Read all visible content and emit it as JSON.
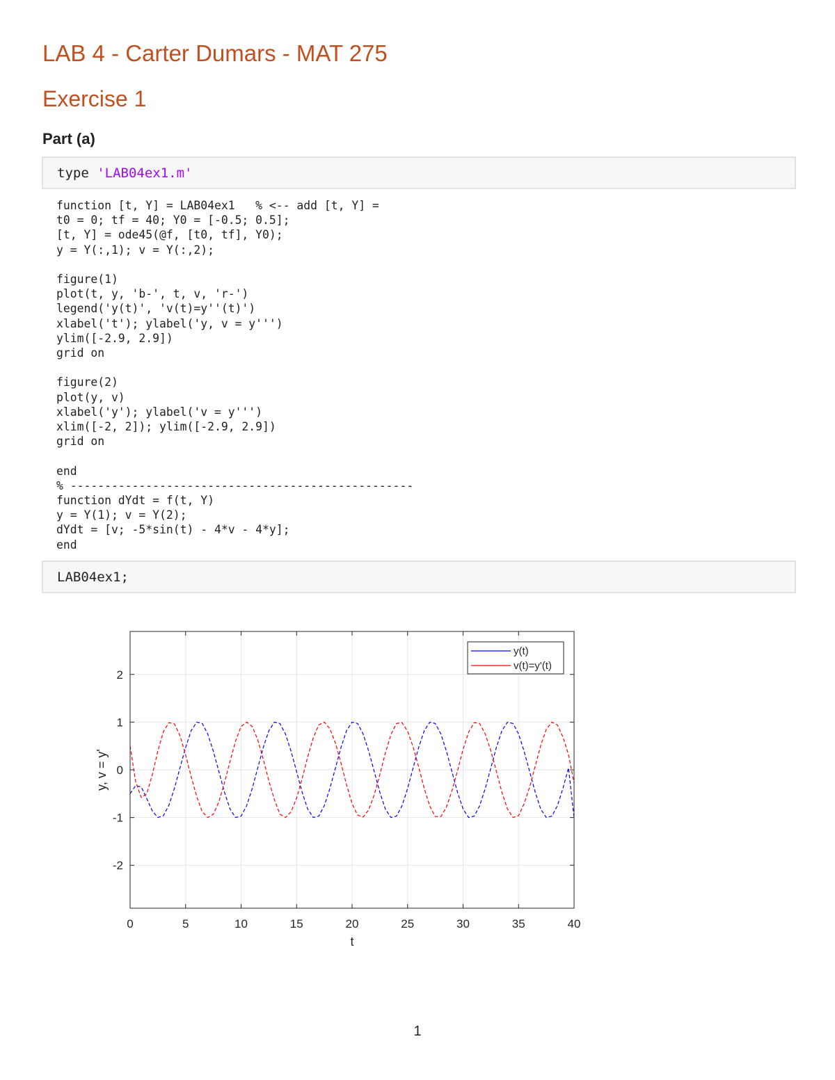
{
  "title": "LAB 4 - Carter Dumars - MAT 275",
  "section": "Exercise 1",
  "subsection": "Part (a)",
  "command1": {
    "keyword": "type",
    "argument": "'LAB04ex1.m'"
  },
  "code_lines": [
    "function [t, Y] = LAB04ex1   % <-- add [t, Y] =",
    "t0 = 0; tf = 40; Y0 = [-0.5; 0.5];",
    "[t, Y] = ode45(@f, [t0, tf], Y0);",
    "y = Y(:,1); v = Y(:,2);",
    "",
    "figure(1)",
    "plot(t, y, 'b-', t, v, 'r-')",
    "legend('y(t)', 'v(t)=y''(t)')",
    "xlabel('t'); ylabel('y, v = y''')",
    "ylim([-2.9, 2.9])",
    "grid on",
    "",
    "figure(2)",
    "plot(y, v)",
    "xlabel('y'); ylabel('v = y''')",
    "xlim([-2, 2]); ylim([-2.9, 2.9])",
    "grid on",
    "",
    "end",
    "% --------------------------------------------------",
    "function dYdt = f(t, Y)",
    "y = Y(1); v = Y(2);",
    "dYdt = [v; -5*sin(t) - 4*v - 4*y];",
    "end"
  ],
  "command2": "LAB04ex1;",
  "page_number": "1",
  "chart_data": {
    "type": "line",
    "xlabel": "t",
    "ylabel": "y, v = y'",
    "xlim": [
      0,
      40
    ],
    "ylim": [
      -2.9,
      2.9
    ],
    "xticks": [
      "0",
      "5",
      "10",
      "15",
      "20",
      "25",
      "30",
      "35",
      "40"
    ],
    "yticks": [
      "-2",
      "-1",
      "0",
      "1",
      "2"
    ],
    "grid": true,
    "legend_position": "top-right",
    "series": [
      {
        "name": "y(t)",
        "color": "#0000ff",
        "x": [
          0,
          0.5,
          1,
          1.5,
          2,
          2.5,
          3,
          3.5,
          4,
          4.5,
          5,
          5.5,
          6,
          6.5,
          7,
          7.5,
          8,
          8.5,
          9,
          9.5,
          10,
          10.5,
          11,
          11.5,
          12,
          12.5,
          13,
          13.5,
          14,
          14.5,
          15,
          15.5,
          16,
          16.5,
          17,
          17.5,
          18,
          18.5,
          19,
          19.5,
          20,
          20.5,
          21,
          21.5,
          22,
          22.5,
          23,
          23.5,
          24,
          24.5,
          25,
          25.5,
          26,
          26.5,
          27,
          27.5,
          28,
          28.5,
          29,
          29.5,
          30,
          30.5,
          31,
          31.5,
          32,
          32.5,
          33,
          33.5,
          34,
          34.5,
          35,
          35.5,
          36,
          36.5,
          37,
          37.5,
          38,
          38.5,
          39,
          39.5,
          40
        ],
        "y": [
          -0.5,
          -0.33,
          -0.36,
          -0.6,
          -0.86,
          -1.0,
          -0.96,
          -0.74,
          -0.38,
          0.05,
          0.47,
          0.82,
          1.0,
          0.97,
          0.75,
          0.39,
          -0.04,
          -0.47,
          -0.82,
          -1.0,
          -0.97,
          -0.75,
          -0.39,
          0.04,
          0.47,
          0.82,
          1.0,
          0.97,
          0.75,
          0.39,
          -0.04,
          -0.47,
          -0.82,
          -1.0,
          -0.97,
          -0.75,
          -0.39,
          0.04,
          0.47,
          0.82,
          1.0,
          0.97,
          0.75,
          0.39,
          -0.04,
          -0.47,
          -0.82,
          -1.0,
          -0.97,
          -0.75,
          -0.39,
          0.04,
          0.47,
          0.82,
          1.0,
          0.97,
          0.75,
          0.39,
          -0.04,
          -0.47,
          -0.82,
          -1.0,
          -0.97,
          -0.75,
          -0.39,
          0.04,
          0.47,
          0.82,
          1.0,
          0.97,
          0.75,
          0.39,
          -0.04,
          -0.47,
          -0.82,
          -1.0,
          -0.97,
          -0.75,
          -0.39,
          0.04,
          -1.0
        ]
      },
      {
        "name": "v(t)=y'(t)",
        "color": "#ff0000",
        "x": [
          0,
          0.5,
          1,
          1.5,
          2,
          2.5,
          3,
          3.5,
          4,
          4.5,
          5,
          5.5,
          6,
          6.5,
          7,
          7.5,
          8,
          8.5,
          9,
          9.5,
          10,
          10.5,
          11,
          11.5,
          12,
          12.5,
          13,
          13.5,
          14,
          14.5,
          15,
          15.5,
          16,
          16.5,
          17,
          17.5,
          18,
          18.5,
          19,
          19.5,
          20,
          20.5,
          21,
          21.5,
          22,
          22.5,
          23,
          23.5,
          24,
          24.5,
          25,
          25.5,
          26,
          26.5,
          27,
          27.5,
          28,
          28.5,
          29,
          29.5,
          30,
          30.5,
          31,
          31.5,
          32,
          32.5,
          33,
          33.5,
          34,
          34.5,
          35,
          35.5,
          36,
          36.5,
          37,
          37.5,
          38,
          38.5,
          39,
          39.5,
          40
        ],
        "y": [
          0.5,
          -0.25,
          -0.58,
          -0.5,
          -0.1,
          0.4,
          0.8,
          0.99,
          0.96,
          0.71,
          0.31,
          -0.14,
          -0.56,
          -0.88,
          -1.0,
          -0.93,
          -0.67,
          -0.27,
          0.18,
          0.6,
          0.91,
          1.0,
          0.91,
          0.63,
          0.22,
          -0.23,
          -0.63,
          -0.93,
          -1.0,
          -0.88,
          -0.59,
          -0.18,
          0.27,
          0.67,
          0.94,
          1.0,
          0.86,
          0.56,
          0.14,
          -0.31,
          -0.71,
          -0.95,
          -0.99,
          -0.84,
          -0.52,
          -0.1,
          0.35,
          0.74,
          0.97,
          0.99,
          0.81,
          0.48,
          0.06,
          -0.39,
          -0.76,
          -0.98,
          -0.98,
          -0.78,
          -0.44,
          -0.02,
          0.43,
          0.79,
          0.99,
          0.97,
          0.75,
          0.4,
          -0.03,
          -0.47,
          -0.82,
          -1.0,
          -0.96,
          -0.71,
          -0.36,
          0.08,
          0.51,
          0.85,
          1.0,
          0.94,
          0.69,
          0.32,
          -0.28
        ]
      }
    ]
  }
}
